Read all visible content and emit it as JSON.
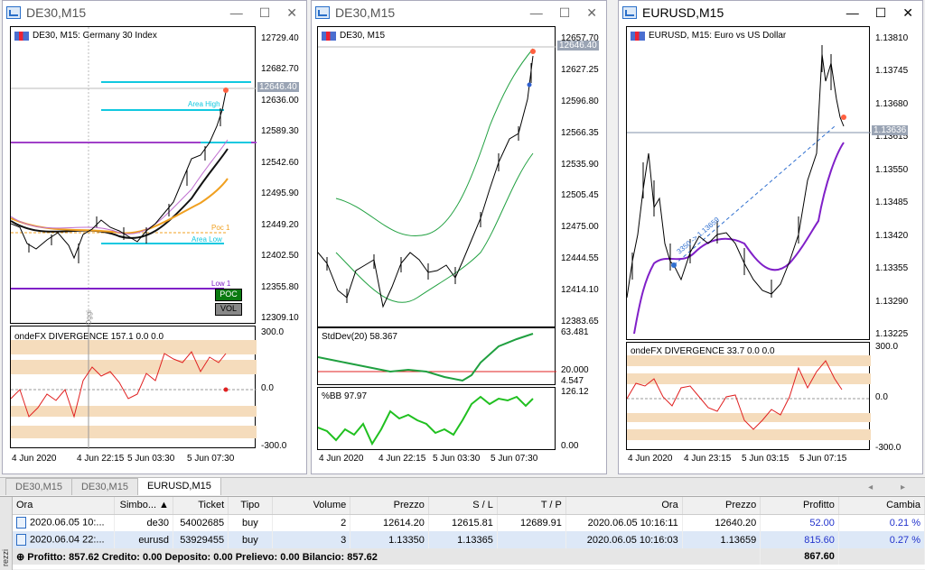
{
  "windows": [
    {
      "title": "DE30,M15",
      "chart_header": "DE30, M15:  Germany 30 Index",
      "price_ticks": [
        "12729.40",
        "12682.70",
        "12636.00",
        "12589.30",
        "12542.60",
        "12495.90",
        "12449.20",
        "12402.50",
        "12355.80",
        "12309.10"
      ],
      "price_badge": "12646.40",
      "labels": {
        "area_high": "Area High",
        "area_low": "Area Low",
        "poc": "Poc 1",
        "low": "Low 1",
        "oggi": "Oggi"
      },
      "buttons": {
        "poc": "POC",
        "vol": "VOL"
      },
      "indicator": "ondeFX DIVERGENCE 157.1 0.0 0.0",
      "ind_ticks": [
        "300.0",
        "0.0",
        "-300.0"
      ],
      "x_labels": [
        "4 Jun 2020",
        "4 Jun 22:15",
        "5 Jun 03:30",
        "5 Jun 07:30"
      ]
    },
    {
      "title": "DE30,M15",
      "chart_header": "DE30, M15",
      "price_ticks": [
        "12657.70",
        "12627.25",
        "12596.80",
        "12566.35",
        "12535.90",
        "12505.45",
        "12475.00",
        "12444.55",
        "12414.10",
        "12383.65"
      ],
      "price_badge": "12646.40",
      "indicator": "StdDev(20) 58.367",
      "ind_ticks": [
        "63.481",
        "20.000",
        "4.547"
      ],
      "indicator2": "%BB 97.97",
      "ind2_ticks": [
        "126.12",
        "0.00"
      ],
      "x_labels": [
        "4 Jun 2020",
        "4 Jun 22:15",
        "5 Jun 03:30",
        "5 Jun 07:30"
      ]
    },
    {
      "title": "EURUSD,M15",
      "chart_header": "EURUSD, M15:  Euro vs US Dollar",
      "price_ticks": [
        "1.13810",
        "1.13745",
        "1.13680",
        "1.13615",
        "1.13550",
        "1.13485",
        "1.13420",
        "1.13355",
        "1.13290",
        "1.13225"
      ],
      "price_badge": "1.13636",
      "trade_line_label": "3350 -> 1.13659",
      "indicator": "ondeFX DIVERGENCE 33.7 0.0 0.0",
      "ind_ticks": [
        "300.0",
        "0.0",
        "-300.0"
      ],
      "x_labels": [
        "4 Jun 2020",
        "4 Jun 23:15",
        "5 Jun 03:15",
        "5 Jun 07:15"
      ]
    }
  ],
  "window_controls": {
    "minimize": "—",
    "maximize": "☐",
    "close": "✕"
  },
  "tabs": [
    "DE30,M15",
    "DE30,M15",
    "EURUSD,M15"
  ],
  "active_tab": 2,
  "tab_arrows": "◂ ▸",
  "terminal": {
    "side_label": "rezzi",
    "columns": [
      "Ora",
      "Simbo...",
      "Ticket",
      "Tipo",
      "Volume",
      "Prezzo",
      "S / L",
      "T / P",
      "Ora",
      "Prezzo",
      "Profitto",
      "Cambia"
    ],
    "rows": [
      [
        "2020.06.05 10:...",
        "de30",
        "54002685",
        "buy",
        "2",
        "12614.20",
        "12615.81",
        "12689.91",
        "2020.06.05 10:16:11",
        "12640.20",
        "52.00",
        "0.21 %"
      ],
      [
        "2020.06.04 22:...",
        "eurusd",
        "53929455",
        "buy",
        "3",
        "1.13350",
        "1.13365",
        "",
        "2020.06.05 10:16:03",
        "1.13659",
        "815.60",
        "0.27 %"
      ]
    ],
    "summary": "Profitto: 857.62  Credito: 0.00  Deposito: 0.00  Prelievo: 0.00  Bilancio: 857.62",
    "summary_total": "867.60"
  }
}
